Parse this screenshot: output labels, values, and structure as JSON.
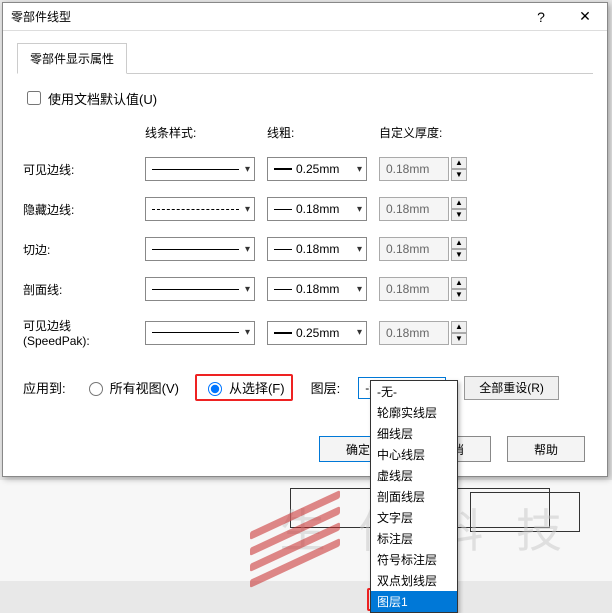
{
  "dialog": {
    "title": "零部件线型",
    "tab": "零部件显示属性",
    "use_doc_default": "使用文档默认值(U)",
    "headers": {
      "style": "线条样式:",
      "weight": "线粗:",
      "custom": "自定义厚度:"
    },
    "rows": [
      {
        "label": "可见边线:",
        "weight": "0.25mm",
        "custom": "0.18mm",
        "dashed": false
      },
      {
        "label": "隐藏边线:",
        "weight": "0.18mm",
        "custom": "0.18mm",
        "dashed": true
      },
      {
        "label": "切边:",
        "weight": "0.18mm",
        "custom": "0.18mm",
        "dashed": false
      },
      {
        "label": "剖面线:",
        "weight": "0.18mm",
        "custom": "0.18mm",
        "dashed": false
      },
      {
        "label": "可见边线 (SpeedPak):",
        "weight": "0.25mm",
        "custom": "0.18mm",
        "dashed": false
      }
    ],
    "apply_to": "应用到:",
    "radio_all": "所有视图(V)",
    "radio_sel": "从选择(F)",
    "layer_label": "图层:",
    "layer_current": "-无-",
    "reset": "全部重设(R)",
    "ok": "确定",
    "cancel": "取消",
    "help": "帮助",
    "layer_options": [
      "-无-",
      "轮廓实线层",
      "细线层",
      "中心线层",
      "虚线层",
      "剖面线层",
      "文字层",
      "标注层",
      "符号标注层",
      "双点划线层",
      "图层1"
    ],
    "layer_selected_index": 10
  }
}
